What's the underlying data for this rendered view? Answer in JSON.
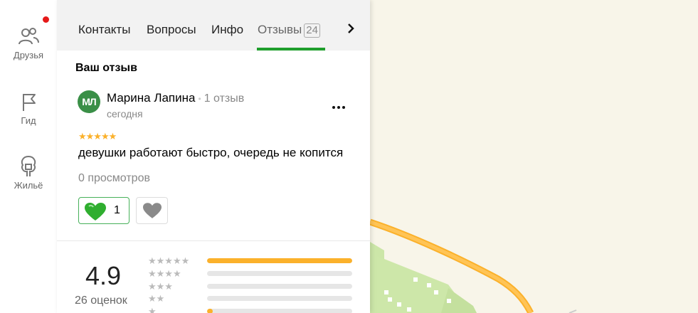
{
  "colors": {
    "accent_green": "#1f9e2c",
    "star_yellow": "#fbb12b",
    "notification_red": "#e51919"
  },
  "nav": {
    "items": [
      {
        "label": "Друзья",
        "icon": "friends-icon",
        "has_notification": true
      },
      {
        "label": "Гид",
        "icon": "flag-icon"
      },
      {
        "label": "Жильё",
        "icon": "house-icon"
      }
    ]
  },
  "tabs": [
    {
      "label": "Контакты"
    },
    {
      "label": "Вопросы"
    },
    {
      "label": "Инфо"
    },
    {
      "label": "Отзывы",
      "count": "24",
      "active": true
    }
  ],
  "section_title": "Ваш отзыв",
  "review": {
    "avatar_initials": "МЛ",
    "author": "Марина Лапина",
    "author_reviews": "1 отзыв",
    "date": "сегодня",
    "rating": 5,
    "stars": "★★★★★",
    "text": "девушки работают быстро, очередь не копится",
    "views": "0 просмотров",
    "likes": "1"
  },
  "summary": {
    "rating": "4.9",
    "count_label": "26 оценок",
    "distribution": [
      {
        "stars": "★★★★★",
        "fraction": 1.0
      },
      {
        "stars": "★★★★",
        "fraction": 0.0
      },
      {
        "stars": "★★★",
        "fraction": 0.0
      },
      {
        "stars": "★★",
        "fraction": 0.0
      },
      {
        "stars": "★",
        "fraction": 0.04
      }
    ]
  }
}
